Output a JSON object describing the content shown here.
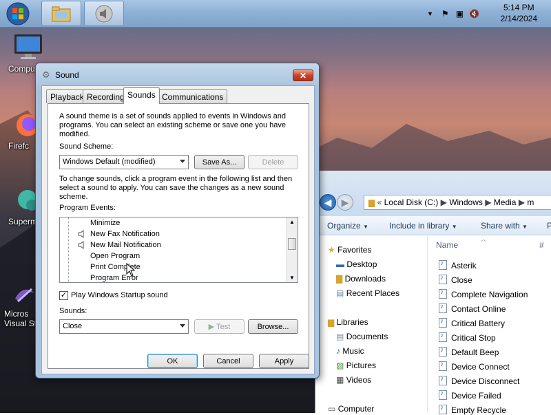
{
  "taskbar": {
    "clock_time": "5:14 PM",
    "clock_date": "2/14/2024"
  },
  "desktop_icons": [
    {
      "label": "Compu",
      "icon": "monitor-icon"
    },
    {
      "label": "Firefc",
      "icon": "firefox-icon"
    },
    {
      "label": "Superm",
      "icon": "app-icon"
    },
    {
      "label": "Micros\nVisual St",
      "icon": "visual-studio-icon"
    }
  ],
  "dialog": {
    "title": "Sound",
    "close_label": "✕",
    "tabs": [
      "Playback",
      "Recording",
      "Sounds",
      "Communications"
    ],
    "active_tab": "Sounds",
    "intro": "A sound theme is a set of sounds applied to events in Windows and programs.  You can select an existing scheme or save one you have modified.",
    "scheme_label": "Sound Scheme:",
    "scheme_value": "Windows Default (modified)",
    "save_as_label": "Save As...",
    "delete_label": "Delete",
    "instructions": "To change sounds, click a program event in the following list and then select a sound to apply.  You can save the changes as a new sound scheme.",
    "events_label": "Program Events:",
    "events": [
      {
        "name": "Minimize",
        "has_sound": false
      },
      {
        "name": "New Fax Notification",
        "has_sound": true
      },
      {
        "name": "New Mail Notification",
        "has_sound": true
      },
      {
        "name": "Open Program",
        "has_sound": false
      },
      {
        "name": "Print Complete",
        "has_sound": false
      },
      {
        "name": "Program Error",
        "has_sound": false
      }
    ],
    "startup_checkbox_label": "Play Windows Startup sound",
    "startup_checked": true,
    "sounds_label": "Sounds:",
    "sound_value": "Close",
    "test_label": "Test",
    "browse_label": "Browse...",
    "ok_label": "OK",
    "cancel_label": "Cancel",
    "apply_label": "Apply"
  },
  "explorer": {
    "address": [
      "Local Disk (C:)",
      "Windows",
      "Media",
      "m"
    ],
    "toolbar": [
      "Organize",
      "Include in library",
      "Share with",
      "P"
    ],
    "column_header": "Name",
    "column_header2": "#",
    "nav": {
      "favorites": "Favorites",
      "favorites_items": [
        "Desktop",
        "Downloads",
        "Recent Places"
      ],
      "libraries": "Libraries",
      "libraries_items": [
        "Documents",
        "Music",
        "Pictures",
        "Videos"
      ],
      "computer": "Computer"
    },
    "files": [
      "Asterik",
      "Close",
      "Complete Navigation",
      "Contact Online",
      "Critical Battery",
      "Critical Stop",
      "Default Beep",
      "Device Connect",
      "Device Disconnect",
      "Device Failed",
      "Empty Recycle"
    ]
  }
}
